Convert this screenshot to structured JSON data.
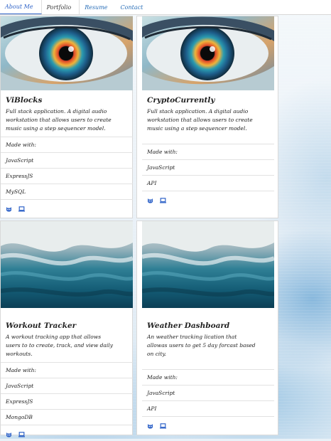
{
  "nav": {
    "items": [
      {
        "label": "About Me"
      },
      {
        "label": "Portfolio"
      },
      {
        "label": "Resume"
      },
      {
        "label": "Contact"
      }
    ]
  },
  "cards": [
    {
      "title": "ViBlocks",
      "description": "Full stack application. A digital audio workstation that allows users to create music using a step sequencer model.",
      "made_with_label": "Made with:",
      "tech": [
        "JavaScript",
        "ExpressJS",
        "MySQL"
      ],
      "image": "eye-artwork"
    },
    {
      "title": "CryptoCurrently",
      "description": "Full stack application. A digital audio workstation that allows users to create music using a step sequencer model.",
      "made_with_label": "Made with:",
      "tech": [
        "JavaScript",
        "API"
      ],
      "image": "eye-artwork"
    },
    {
      "title": "Workout Tracker",
      "description": "A workout tracking app that allows users to to create, track, and view daily workouts.",
      "made_with_label": "Made with:",
      "tech": [
        "JavaScript",
        "ExpressJS",
        "MongoDB"
      ],
      "image": "ocean-wave"
    },
    {
      "title": "Weather Dashboard",
      "description": "An weather tracking lication that allowas users to get 5 day forcast based on city.",
      "made_with_label": "Made with:",
      "tech": [
        "JavaScript",
        "API"
      ],
      "image": "ocean-wave"
    }
  ],
  "icons": {
    "repo": "github-icon",
    "demo": "laptop-icon"
  },
  "colors": {
    "link": "#2a6fb8",
    "icon": "#2f63c8"
  }
}
